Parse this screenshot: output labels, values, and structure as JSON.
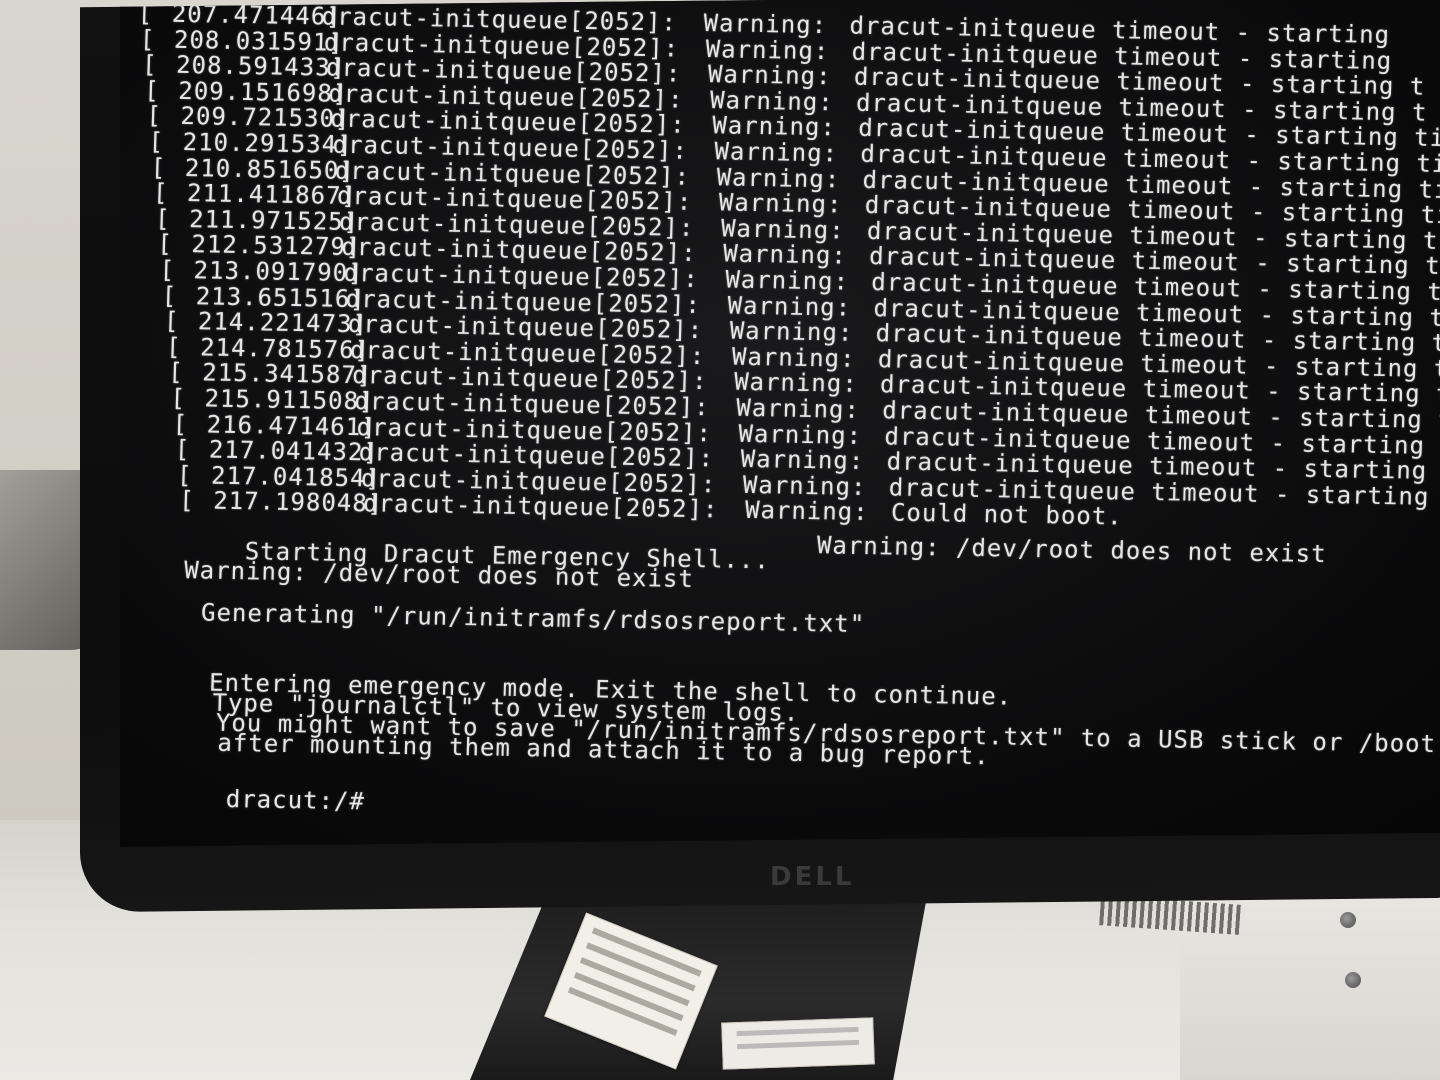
{
  "terminal": {
    "log_lines": [
      {
        "bracket": "[",
        "time": "207.471446]",
        "proc": "dracut-initqueue[2052]:",
        "level": "Warning:",
        "msg": "dracut-initqueue timeout - starting"
      },
      {
        "bracket": "[",
        "time": "208.031591]",
        "proc": "dracut-initqueue[2052]:",
        "level": "Warning:",
        "msg": "dracut-initqueue timeout - starting"
      },
      {
        "bracket": "[",
        "time": "208.591433]",
        "proc": "dracut-initqueue[2052]:",
        "level": "Warning:",
        "msg": "dracut-initqueue timeout - starting t"
      },
      {
        "bracket": "[",
        "time": "209.151698]",
        "proc": "dracut-initqueue[2052]:",
        "level": "Warning:",
        "msg": "dracut-initqueue timeout - starting t"
      },
      {
        "bracket": "[",
        "time": "209.721530]",
        "proc": "dracut-initqueue[2052]:",
        "level": "Warning:",
        "msg": "dracut-initqueue timeout - starting ti"
      },
      {
        "bracket": "[",
        "time": "210.291534]",
        "proc": "dracut-initqueue[2052]:",
        "level": "Warning:",
        "msg": "dracut-initqueue timeout - starting ti"
      },
      {
        "bracket": "[",
        "time": "210.851650]",
        "proc": "dracut-initqueue[2052]:",
        "level": "Warning:",
        "msg": "dracut-initqueue timeout - starting tin"
      },
      {
        "bracket": "[",
        "time": "211.411867]",
        "proc": "dracut-initqueue[2052]:",
        "level": "Warning:",
        "msg": "dracut-initqueue timeout - starting tim"
      },
      {
        "bracket": "[",
        "time": "211.971525]",
        "proc": "dracut-initqueue[2052]:",
        "level": "Warning:",
        "msg": "dracut-initqueue timeout - starting time"
      },
      {
        "bracket": "[",
        "time": "212.531279]",
        "proc": "dracut-initqueue[2052]:",
        "level": "Warning:",
        "msg": "dracut-initqueue timeout - starting time"
      },
      {
        "bracket": "[",
        "time": "213.091790]",
        "proc": "dracut-initqueue[2052]:",
        "level": "Warning:",
        "msg": "dracut-initqueue timeout - starting time"
      },
      {
        "bracket": "[",
        "time": "213.651516]",
        "proc": "dracut-initqueue[2052]:",
        "level": "Warning:",
        "msg": "dracut-initqueue timeout - starting timed"
      },
      {
        "bracket": "[",
        "time": "214.221473]",
        "proc": "dracut-initqueue[2052]:",
        "level": "Warning:",
        "msg": "dracut-initqueue timeout - starting timeo"
      },
      {
        "bracket": "[",
        "time": "214.781576]",
        "proc": "dracut-initqueue[2052]:",
        "level": "Warning:",
        "msg": "dracut-initqueue timeout - starting timeou"
      },
      {
        "bracket": "[",
        "time": "215.341587]",
        "proc": "dracut-initqueue[2052]:",
        "level": "Warning:",
        "msg": "dracut-initqueue timeout - starting timeou"
      },
      {
        "bracket": "[",
        "time": "215.911508]",
        "proc": "dracut-initqueue[2052]:",
        "level": "Warning:",
        "msg": "dracut-initqueue timeout - starting timeou"
      },
      {
        "bracket": "[",
        "time": "216.471461]",
        "proc": "dracut-initqueue[2052]:",
        "level": "Warning:",
        "msg": "dracut-initqueue timeout - starting timeout"
      },
      {
        "bracket": "[",
        "time": "217.041432]",
        "proc": "dracut-initqueue[2052]:",
        "level": "Warning:",
        "msg": "dracut-initqueue timeout - starting timeout"
      },
      {
        "bracket": "[",
        "time": "217.041854]",
        "proc": "dracut-initqueue[2052]:",
        "level": "Warning:",
        "msg": "dracut-initqueue timeout - starting timeout"
      },
      {
        "bracket": "[",
        "time": "217.198048]",
        "proc": "dracut-initqueue[2052]:",
        "level": "Warning:",
        "msg": "Could not boot."
      }
    ],
    "dev_root_inline": "Warning: /dev/root does not exist",
    "emergency_shell": "Starting Dracut Emergency Shell...",
    "dev_root_warning": "Warning: /dev/root does not exist",
    "generating": "Generating \"/run/initramfs/rdsosreport.txt\"",
    "entering": "Entering emergency mode. Exit the shell to continue.",
    "type_journal": "Type \"journalctl\" to view system logs.",
    "save_hint": "You might want to save \"/run/initramfs/rdsosreport.txt\" to a USB stick or /boot",
    "after_mounting": "after mounting them and attach it to a bug report.",
    "prompt": "dracut:/#"
  },
  "monitor": {
    "brand_logo": "DELL"
  }
}
